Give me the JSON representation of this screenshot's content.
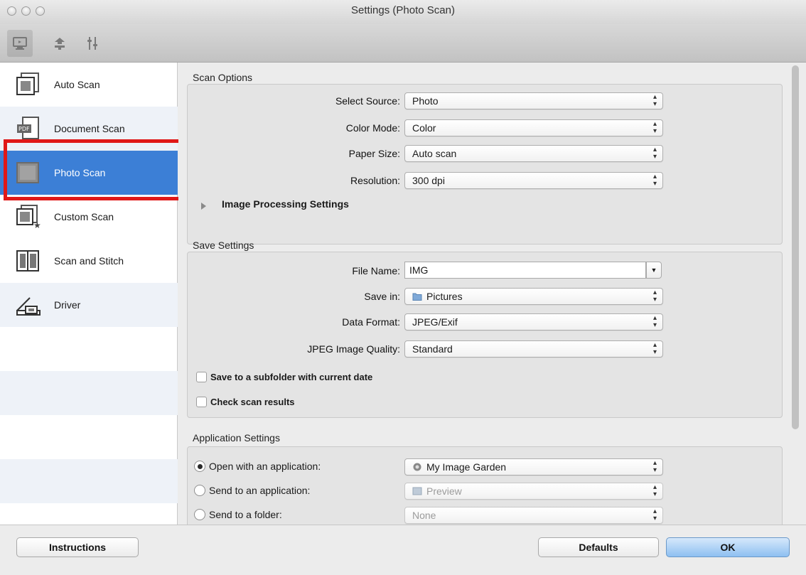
{
  "window": {
    "title": "Settings (Photo Scan)"
  },
  "toolbar": {
    "icons": [
      "scan-from-computer-icon",
      "scan-from-operation-panel-icon",
      "general-settings-icon"
    ]
  },
  "sidebar": {
    "items": [
      {
        "label": "Auto Scan",
        "icon": "auto-scan-icon"
      },
      {
        "label": "Document Scan",
        "icon": "document-scan-icon"
      },
      {
        "label": "Photo Scan",
        "icon": "photo-scan-icon",
        "selected": true
      },
      {
        "label": "Custom Scan",
        "icon": "custom-scan-icon"
      },
      {
        "label": "Scan and Stitch",
        "icon": "scan-and-stitch-icon"
      },
      {
        "label": "Driver",
        "icon": "driver-icon"
      }
    ]
  },
  "scan_options": {
    "title": "Scan Options",
    "select_source": {
      "label": "Select Source:",
      "value": "Photo"
    },
    "color_mode": {
      "label": "Color Mode:",
      "value": "Color"
    },
    "paper_size": {
      "label": "Paper Size:",
      "value": "Auto scan"
    },
    "resolution": {
      "label": "Resolution:",
      "value": "300 dpi"
    },
    "image_processing": "Image Processing Settings"
  },
  "save_settings": {
    "title": "Save Settings",
    "file_name": {
      "label": "File Name:",
      "value": "IMG"
    },
    "save_in": {
      "label": "Save in:",
      "value": "Pictures"
    },
    "data_format": {
      "label": "Data Format:",
      "value": "JPEG/Exif"
    },
    "jpeg_quality": {
      "label": "JPEG Image Quality:",
      "value": "Standard"
    },
    "subfolder": "Save to a subfolder with current date",
    "check_results": "Check scan results"
  },
  "application_settings": {
    "title": "Application Settings",
    "open_with": {
      "label": "Open with an application:",
      "value": "My Image Garden"
    },
    "send_to_app": {
      "label": "Send to an application:",
      "value": "Preview"
    },
    "send_to_folder": {
      "label": "Send to a folder:",
      "value": "None"
    }
  },
  "footer": {
    "instructions": "Instructions",
    "defaults": "Defaults",
    "ok": "OK"
  },
  "colors": {
    "selection": "#3c7fd6",
    "highlight_box": "#e01818",
    "ok_button": "#8ec0f1"
  }
}
